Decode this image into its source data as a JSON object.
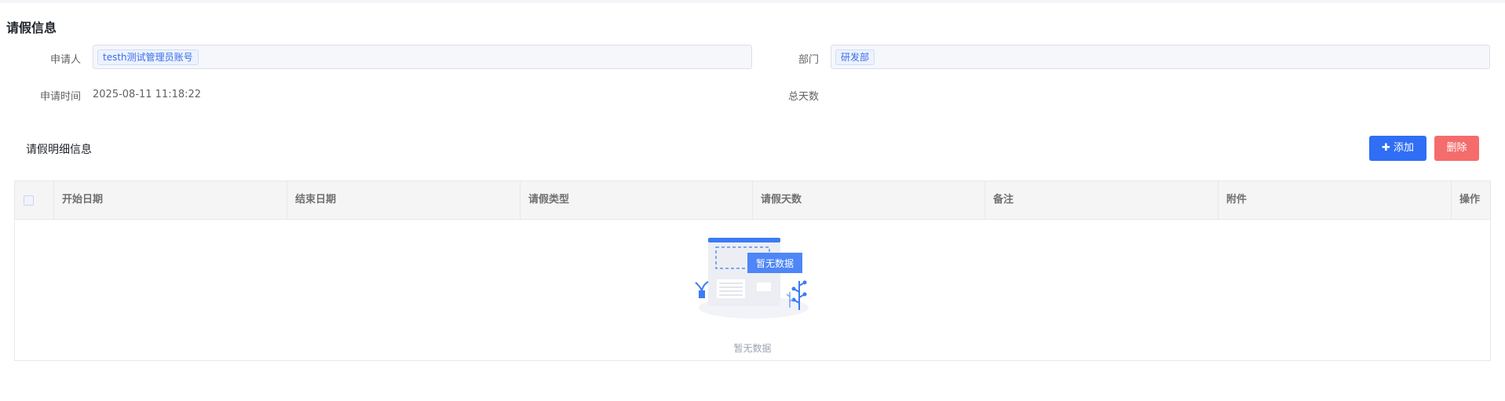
{
  "section_title": "请假信息",
  "form": {
    "applicant_label": "申请人",
    "applicant_value": "testh测试管理员账号",
    "department_label": "部门",
    "department_value": "研发部",
    "time_label": "申请时间",
    "time_value": "2025-08-11 11:18:22",
    "total_days_label": "总天数",
    "total_days_value": ""
  },
  "detail": {
    "title": "请假明细信息",
    "add_label": "添加",
    "delete_label": "删除"
  },
  "table": {
    "columns": [
      "开始日期",
      "结束日期",
      "请假类型",
      "请假天数",
      "备注",
      "附件",
      "操作"
    ],
    "rows": []
  },
  "empty": {
    "illustration_label": "暂无数据",
    "text": "暂无数据"
  },
  "colors": {
    "primary": "#2f6ef5",
    "danger": "#f56c6c",
    "tag_bg": "#ecf2ff"
  }
}
